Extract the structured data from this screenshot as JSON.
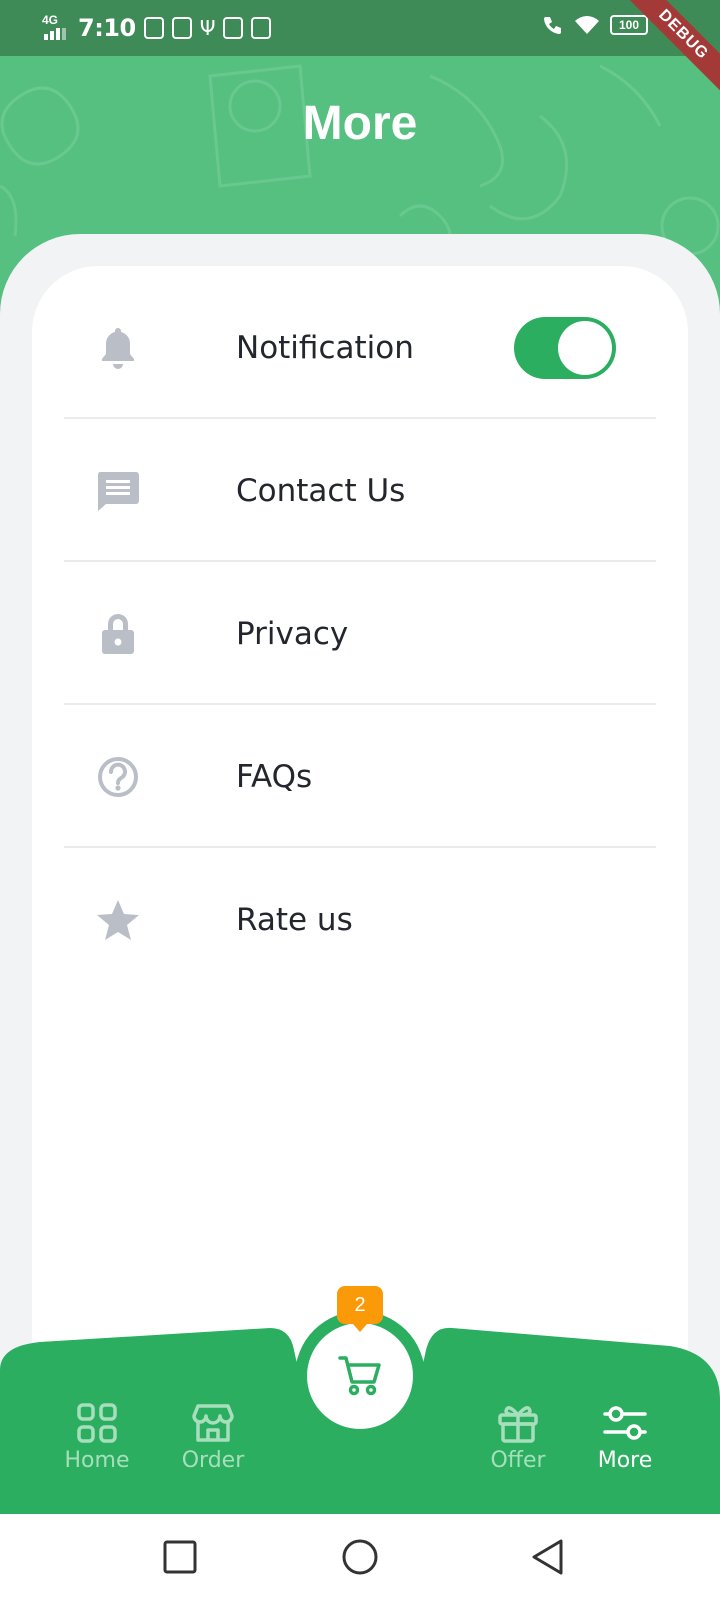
{
  "status_bar": {
    "network": "4G",
    "time": "7:10",
    "battery": "100",
    "debug_ribbon": "DEBUG"
  },
  "header": {
    "title": "More"
  },
  "menu": {
    "items": [
      {
        "label": "Notification",
        "icon": "bell-icon"
      },
      {
        "label": "Contact Us",
        "icon": "chat-icon"
      },
      {
        "label": "Privacy",
        "icon": "lock-icon"
      },
      {
        "label": "FAQs",
        "icon": "question-circle-icon"
      },
      {
        "label": "Rate us",
        "icon": "star-icon"
      }
    ],
    "notification_enabled": true
  },
  "cart": {
    "badge_count": "2",
    "icon": "cart-icon"
  },
  "bottom_nav": {
    "items": [
      {
        "label": "Home",
        "icon": "grid-icon",
        "active": false
      },
      {
        "label": "Order",
        "icon": "store-icon",
        "active": false
      },
      {
        "label": "Offer",
        "icon": "gift-icon",
        "active": false
      },
      {
        "label": "More",
        "icon": "sliders-icon",
        "active": true
      }
    ]
  },
  "colors": {
    "primary": "#2bae5f",
    "header_green": "#55c07f",
    "status_bar": "#3f8b58",
    "badge_orange": "#fb9a09",
    "icon_gray": "#b9bec7",
    "background": "#f2f3f5"
  }
}
